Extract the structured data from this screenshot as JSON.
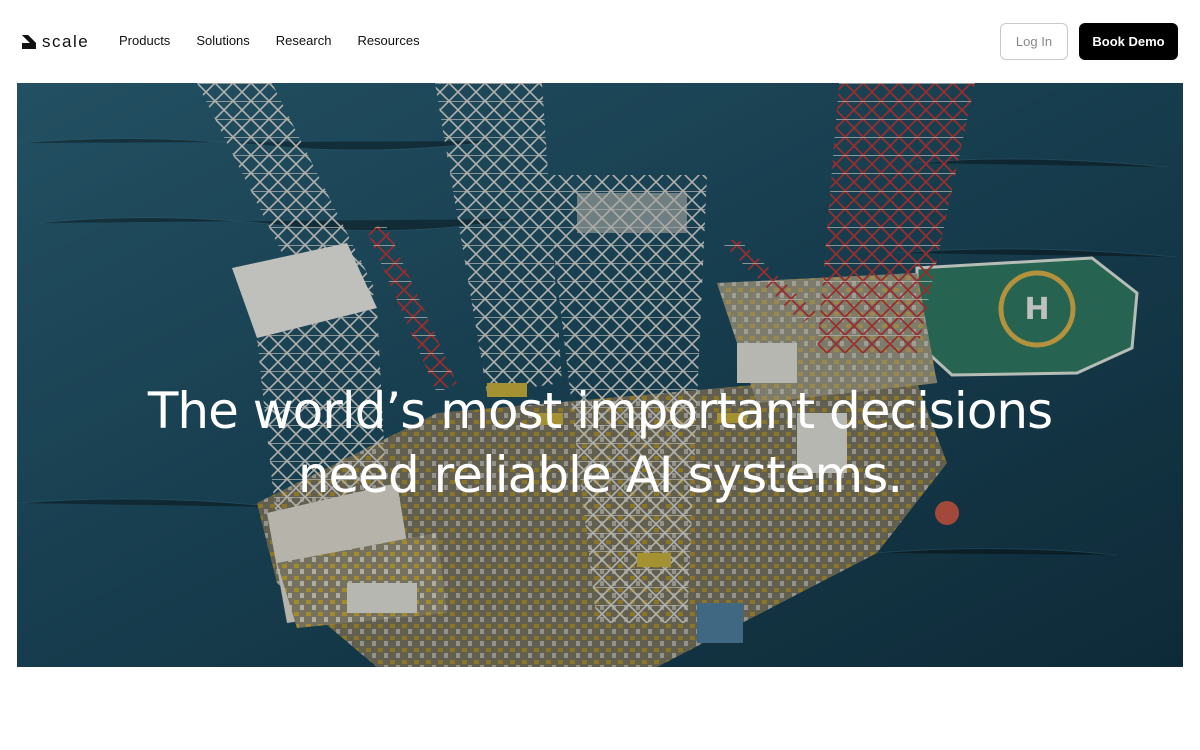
{
  "nav": {
    "logo_text": "scale",
    "links": [
      "Products",
      "Solutions",
      "Research",
      "Resources"
    ],
    "login_label": "Log In",
    "demo_label": "Book Demo"
  },
  "hero": {
    "headline_line1": "The world’s most important decisions",
    "headline_line2": "need reliable AI systems.",
    "image_subject": "offshore oil rig with helipad"
  },
  "colors": {
    "brand": "#000000",
    "sea": "#1d4a5e",
    "helipad": "#2f7a63",
    "rig_red": "#b03030"
  }
}
